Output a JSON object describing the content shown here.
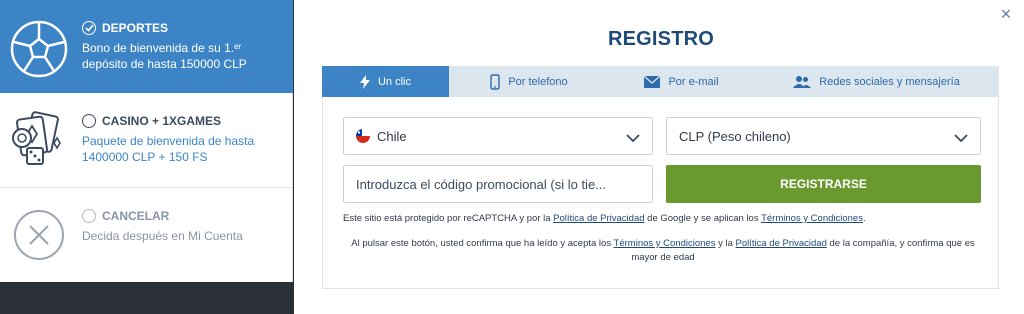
{
  "bonus_options": {
    "sports": {
      "title": "DEPORTES",
      "desc_line1": "Bono de bienvenida de su 1.ᵉʳ",
      "desc_line2": "depósito de hasta 150000 CLP"
    },
    "casino": {
      "title": "CASINO + 1XGAMES",
      "desc_line1": "Paquete de bienvenida de hasta",
      "desc_line2": "1400000 CLP + 150 FS"
    },
    "cancel": {
      "title": "CANCELAR",
      "desc": "Decida después en Mi Cuenta"
    }
  },
  "modal": {
    "title": "REGISTRO",
    "close_icon": "×"
  },
  "tabs": [
    {
      "label": "Un clic",
      "icon": "lightning-icon",
      "active": true
    },
    {
      "label": "Por telefono",
      "icon": "phone-icon",
      "active": false
    },
    {
      "label": "Por e-mail",
      "icon": "envelope-icon",
      "active": false
    },
    {
      "label": "Redes sociales y mensajería",
      "icon": "users-icon",
      "active": false
    }
  ],
  "form": {
    "country": "Chile",
    "currency": "CLP (Peso chileno)",
    "promo_placeholder": "Introduzca el código promocional (si lo tie...",
    "register_label": "REGISTRARSE"
  },
  "legal": {
    "l1_a": "Este sitio está protegido por reCAPTCHA y por la ",
    "l1_link1": "Política de Privacidad",
    "l1_b": " de Google y se aplican los ",
    "l1_link2": "Términos y Condiciones",
    "l1_c": ".",
    "l2_a": "Al pulsar este botón, usted confirma que ha leído y acepta los ",
    "l2_link1": "Términos y Condiciones",
    "l2_b": " y la ",
    "l2_link2": "Política de Privacidad",
    "l2_c": " de la compañía, y confirma que es mayor de edad"
  },
  "colors": {
    "primary_blue": "#3d84c6",
    "title_navy": "#1e4a78",
    "register_green": "#6a9a2f",
    "tab_bar_bg": "#dce6ef"
  }
}
